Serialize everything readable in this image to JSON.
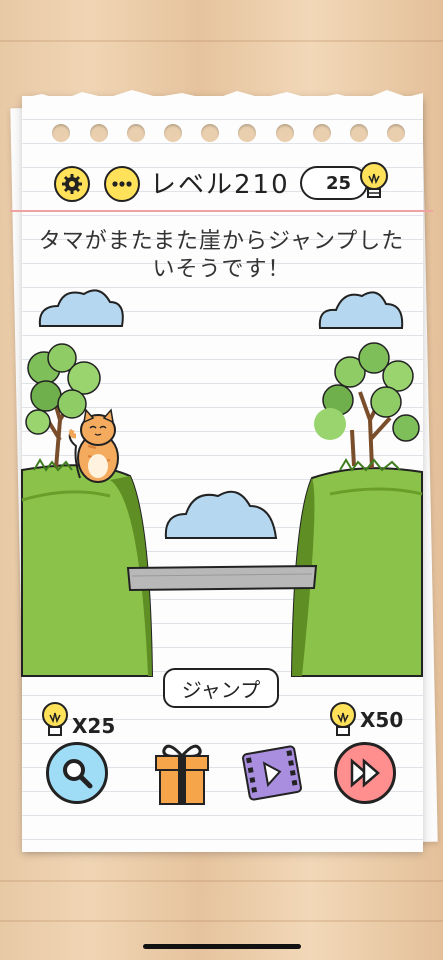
{
  "header": {
    "level_label": "レベル210",
    "hints_count": "25"
  },
  "question": {
    "text": "タマがまたまた崖からジャンプしたいそうです！"
  },
  "actions": {
    "jump_label": "ジャンプ",
    "search_cost": "X25",
    "skip_cost": "X50"
  },
  "icons": {
    "settings": "gear-icon",
    "more": "more-icon",
    "hint": "lightbulb-icon",
    "search": "magnifier-icon",
    "gift": "gift-icon",
    "video": "video-icon",
    "skip": "skip-icon"
  },
  "colors": {
    "accent_yellow": "#ffe15a",
    "grass": "#8bc34a",
    "cliff_dark": "#6a9e2a",
    "search_bg": "#9fdcf5",
    "skip_bg": "#ff8f8f"
  }
}
